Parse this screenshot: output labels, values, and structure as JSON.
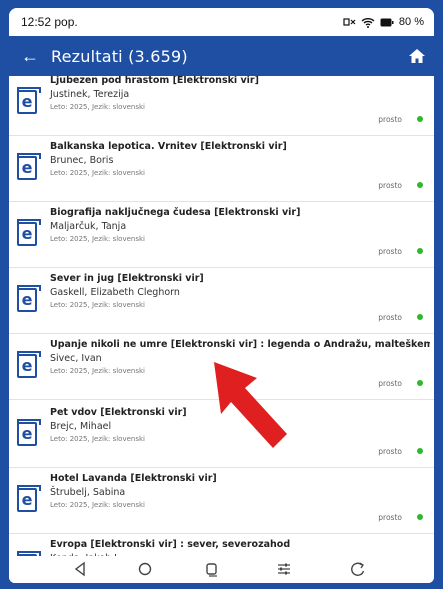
{
  "status": {
    "time": "12:52 pop.",
    "battery": "80 %"
  },
  "appbar": {
    "title": "Rezultati (3.659)"
  },
  "results": [
    {
      "title": "Ljubezen pod hrastom [Elektronski vir]",
      "author": "Justinek, Terezija",
      "meta": "Leto: 2025, Jezik: slovenski",
      "availability": "prosto"
    },
    {
      "title": "Balkanska lepotica. Vrnitev [Elektronski vir]",
      "author": "Brunec, Boris",
      "meta": "Leto: 2025, Jezik: slovenski",
      "availability": "prosto"
    },
    {
      "title": "Biografija naključnega čudesa [Elektronski vir]",
      "author": "Maljarčuk, Tanja",
      "meta": "Leto: 2025, Jezik: slovenski",
      "availability": "prosto"
    },
    {
      "title": "Sever in jug [Elektronski vir]",
      "author": "Gaskell, Elizabeth Cleghorn",
      "meta": "Leto: 2025, Jezik: slovenski",
      "availability": "prosto"
    },
    {
      "title": "Upanje nikoli ne umre [Elektronski vir] : legenda o Andražu, malteškem vitezu s Polzele",
      "author": "Sivec, Ivan",
      "meta": "Leto: 2025, Jezik: slovenski",
      "availability": "prosto"
    },
    {
      "title": "Pet vdov [Elektronski vir]",
      "author": "Brejc, Mihael",
      "meta": "Leto: 2025, Jezik: slovenski",
      "availability": "prosto"
    },
    {
      "title": "Hotel Lavanda [Elektronski vir]",
      "author": "Štrubelj, Sabina",
      "meta": "Leto: 2025, Jezik: slovenski",
      "availability": "prosto"
    },
    {
      "title": "Evropa [Elektronski vir] : sever, severozahod",
      "author": "Kenda, Jakob J.",
      "meta": "",
      "availability": ""
    }
  ],
  "icons": {
    "ebook": "e",
    "back": "←",
    "home": "home-icon"
  },
  "colors": {
    "primary": "#1f4fa3",
    "available": "#2eb82e",
    "annotation_arrow": "#e02020"
  }
}
